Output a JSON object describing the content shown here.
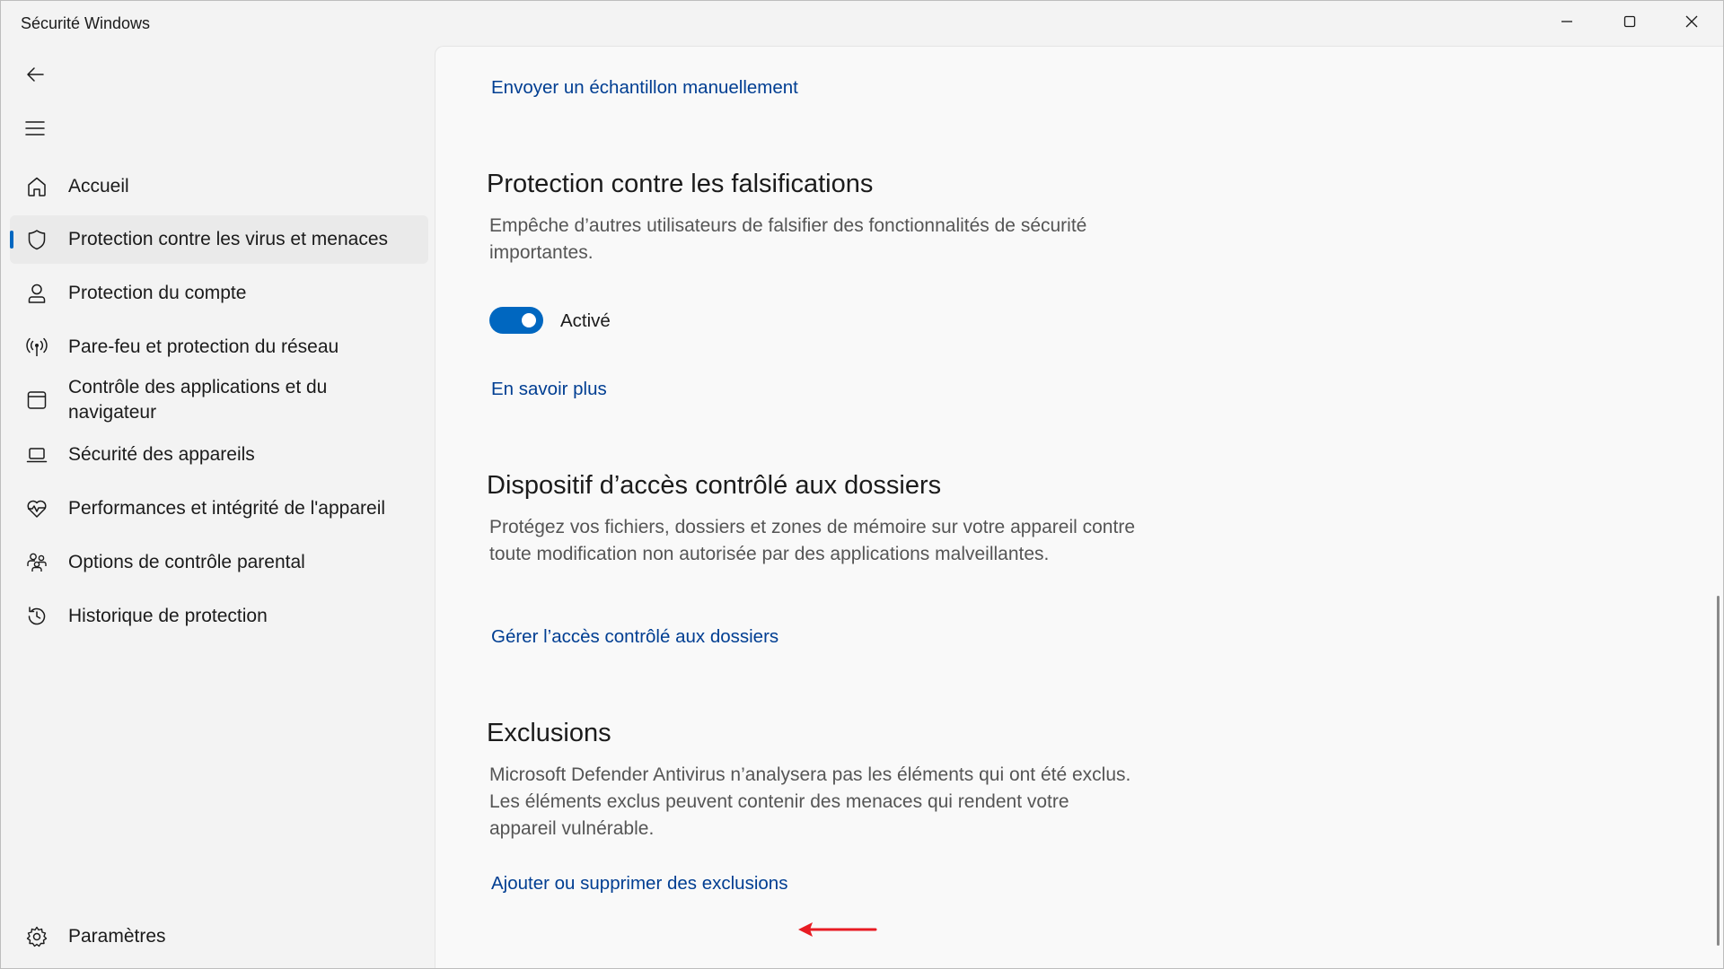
{
  "window": {
    "title": "Sécurité Windows"
  },
  "titlebar_controls": {
    "minimize_icon": "minimize-icon",
    "maximize_icon": "maximize-icon",
    "close_icon": "close-icon"
  },
  "sidebar": {
    "back_icon": "back-arrow-icon",
    "menu_icon": "hamburger-menu-icon",
    "items": [
      {
        "label": "Accueil",
        "icon": "home-icon"
      },
      {
        "label": "Protection contre les virus et menaces",
        "icon": "shield-icon",
        "selected": true
      },
      {
        "label": "Protection du compte",
        "icon": "person-icon"
      },
      {
        "label": "Pare-feu et protection du réseau",
        "icon": "antenna-icon"
      },
      {
        "label": "Contrôle des applications et du navigateur",
        "icon": "browser-window-icon"
      },
      {
        "label": "Sécurité des appareils",
        "icon": "laptop-icon"
      },
      {
        "label": "Performances et intégrité de l'appareil",
        "icon": "heart-pulse-icon"
      },
      {
        "label": "Options de contrôle parental",
        "icon": "family-icon"
      },
      {
        "label": "Historique de protection",
        "icon": "history-icon"
      }
    ],
    "settings": {
      "label": "Paramètres",
      "icon": "gear-icon"
    }
  },
  "main": {
    "submit_sample_link": "Envoyer un échantillon manuellement",
    "tamper": {
      "heading": "Protection contre les falsifications",
      "description": "Empêche d’autres utilisateurs de falsifier des fonctionnalités de sécurité importantes.",
      "toggle_state": "Activé",
      "toggle_on": true,
      "learn_more": "En savoir plus"
    },
    "folder_access": {
      "heading": "Dispositif d’accès contrôlé aux dossiers",
      "description": "Protégez vos fichiers, dossiers et zones de mémoire sur votre appareil contre toute modification non autorisée par des applications malveillantes.",
      "link": "Gérer l’accès contrôlé aux dossiers"
    },
    "exclusions": {
      "heading": "Exclusions",
      "description": "Microsoft Defender Antivirus n’analysera pas les éléments qui ont été exclus. Les éléments exclus peuvent contenir des menaces qui rendent votre appareil vulnérable.",
      "link": "Ajouter ou supprimer des exclusions"
    }
  },
  "colors": {
    "accent": "#0067c0",
    "link": "#003e92",
    "annotation_arrow": "#e81c23"
  }
}
